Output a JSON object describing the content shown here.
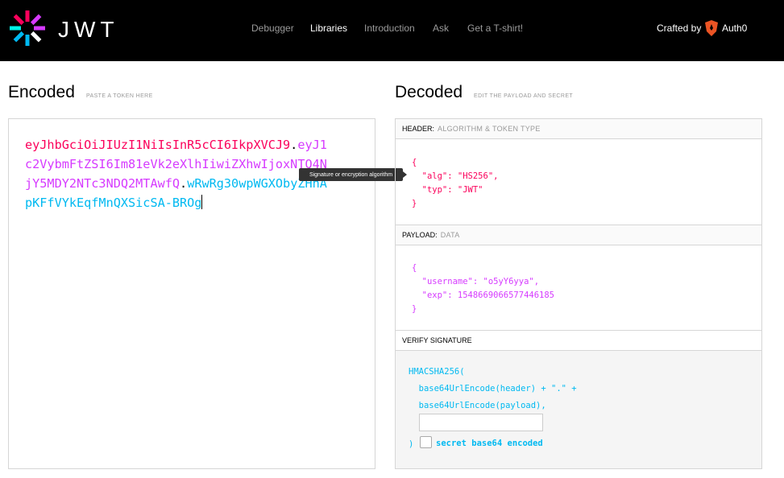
{
  "nav": {
    "wordmark": "JWT",
    "links": [
      "Debugger",
      "Libraries",
      "Introduction",
      "Ask",
      "Get a T-shirt!"
    ],
    "crafted_by": "Crafted by",
    "brand": "Auth0"
  },
  "encoded": {
    "title": "Encoded",
    "subtitle": "PASTE A TOKEN HERE",
    "header_part": "eyJhbGciOiJIUzI1NiIsInR5cCI6IkpXVCJ9",
    "payload_part": "eyJ1c2VybmFtZSI6Im81eVk2eXlhIiwiZXhwIjoxNTQ4NjY5MDY2NTc3NDQ2MTAwfQ",
    "signature_part": "wRwRg30wpWGXObyZHhApKFfVYkEqfMnQXSicSA-BROg",
    "dot": "."
  },
  "tooltip": "Signature or encryption algorithm",
  "decoded": {
    "title": "Decoded",
    "subtitle": "EDIT THE PAYLOAD AND SECRET",
    "header": {
      "label": "HEADER:",
      "sub": "ALGORITHM & TOKEN TYPE",
      "json": "{\n  \"alg\": \"HS256\",\n  \"typ\": \"JWT\"\n}"
    },
    "payload": {
      "label": "PAYLOAD:",
      "sub": "DATA",
      "json": "{\n  \"username\": \"o5yY6yya\",\n  \"exp\": 1548669066577446185\n}"
    },
    "verify": {
      "label": "VERIFY SIGNATURE",
      "line1": "HMACSHA256(",
      "line2": "  base64UrlEncode(header) + \".\" +",
      "line3": "  base64UrlEncode(payload),",
      "secret_value": "",
      "close": ")",
      "checkbox_label": "secret base64 encoded",
      "checkbox_checked": false
    }
  },
  "colors": {
    "header": "#fb015b",
    "payload": "#d63aff",
    "signature": "#00b9f1",
    "navbar": "#000000"
  }
}
